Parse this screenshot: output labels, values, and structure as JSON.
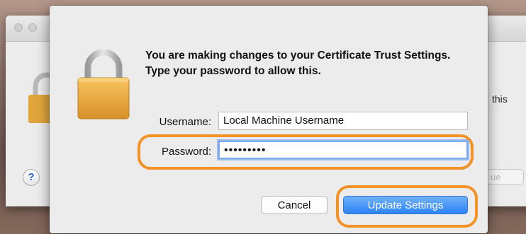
{
  "background_window": {
    "partial_text_right": "this",
    "partial_button_label": "ue",
    "help_label": "?"
  },
  "dialog": {
    "message": "You are making changes to your Certificate Trust Settings. Type your password to allow this.",
    "username": {
      "label": "Username:",
      "value": "Local Machine Username"
    },
    "password": {
      "label": "Password:",
      "value": "•••••••••"
    },
    "buttons": {
      "cancel": "Cancel",
      "confirm": "Update Settings"
    }
  },
  "colors": {
    "annotation_highlight": "#f39227",
    "default_button": "#2d84f5",
    "focus_ring": "#7aaaf0"
  },
  "icons": {
    "dialog_icon": "lock-icon",
    "background_icon": "lock-icon"
  }
}
